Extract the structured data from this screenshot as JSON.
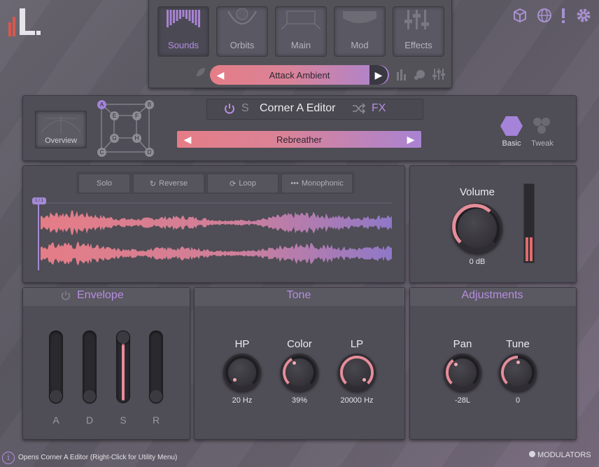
{
  "nav": {
    "tabs": [
      {
        "label": "Sounds",
        "active": true
      },
      {
        "label": "Orbits",
        "active": false
      },
      {
        "label": "Main",
        "active": false
      },
      {
        "label": "Mod",
        "active": false
      },
      {
        "label": "Effects",
        "active": false
      }
    ],
    "preset": "Attack Ambient"
  },
  "editor": {
    "title": "Corner A Editor",
    "s_label": "S",
    "fx_label": "FX",
    "overview_label": "Overview",
    "corners": [
      "A",
      "B",
      "C",
      "D",
      "E",
      "F",
      "G",
      "H"
    ],
    "source": "Rebreather",
    "basic_label": "Basic",
    "tweak_label": "Tweak"
  },
  "waveform": {
    "buttons": [
      {
        "label": "Solo"
      },
      {
        "label": "Reverse"
      },
      {
        "label": "Loop"
      },
      {
        "label": "Monophonic"
      }
    ],
    "start_label": "1 / 1"
  },
  "volume": {
    "label": "Volume",
    "value": "0 dB",
    "level": 0.3
  },
  "envelope": {
    "title": "Envelope",
    "sliders": [
      {
        "label": "A",
        "value": 0.0
      },
      {
        "label": "D",
        "value": 0.0
      },
      {
        "label": "S",
        "value": 1.0
      },
      {
        "label": "R",
        "value": 0.0
      }
    ]
  },
  "tone": {
    "title": "Tone",
    "knobs": [
      {
        "label": "HP",
        "value": "20 Hz",
        "amount": 0.0
      },
      {
        "label": "Color",
        "value": "39%",
        "amount": 0.39
      },
      {
        "label": "LP",
        "value": "20000 Hz",
        "amount": 1.0
      }
    ]
  },
  "adjustments": {
    "title": "Adjustments",
    "knobs": [
      {
        "label": "Pan",
        "value": "-28L",
        "amount": 0.36
      },
      {
        "label": "Tune",
        "value": "0",
        "amount": 0.5
      }
    ]
  },
  "status": {
    "text": "Opens Corner A Editor (Right-Click for Utility Menu)",
    "modulators": "MODULATORS"
  },
  "colors": {
    "accent": "#b58ee0",
    "gradient_start": "#e57d86",
    "gradient_end": "#a983d2"
  }
}
